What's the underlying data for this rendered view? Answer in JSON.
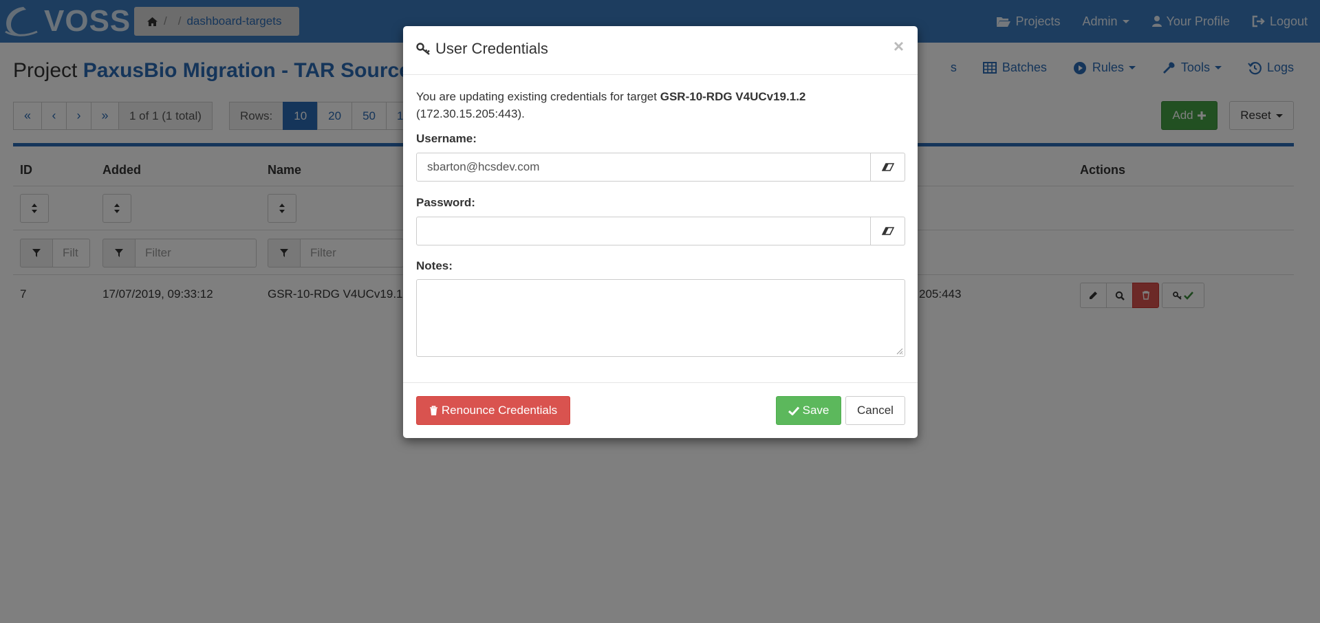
{
  "app": {
    "logo_text": "VOSS"
  },
  "breadcrumb": {
    "separator": "/",
    "current": "dashboard-targets"
  },
  "nav": {
    "projects": "Projects",
    "admin": "Admin",
    "profile": "Your Profile",
    "logout": "Logout"
  },
  "page": {
    "title_prefix": "Project",
    "project_name": "PaxusBio Migration - TAR Source"
  },
  "subnav": {
    "partial": "s",
    "batches": "Batches",
    "rules": "Rules",
    "tools": "Tools",
    "logs": "Logs"
  },
  "pager": {
    "first": "«",
    "prev": "‹",
    "next": "›",
    "last": "»",
    "info": "1 of 1 (1 total)"
  },
  "rows": {
    "label": "Rows:",
    "options": [
      "10",
      "20",
      "50",
      "1"
    ],
    "selected": "10"
  },
  "toolbar": {
    "add_label": "Add",
    "reset_label": "Reset"
  },
  "table": {
    "headers": {
      "id": "ID",
      "added": "Added",
      "name": "Name",
      "actions": "Actions"
    },
    "filters": {
      "id_placeholder": "Filt",
      "added_placeholder": "Filter",
      "name_placeholder": "Filter"
    },
    "rows": [
      {
        "id": "7",
        "added": "17/07/2019, 09:33:12",
        "name": "GSR-10-RDG V4UCv19.1",
        "address": "205:443"
      }
    ]
  },
  "modal": {
    "title": "User Credentials",
    "close": "×",
    "msg_prefix": "You are updating existing credentials for target",
    "target_name": "GSR-10-RDG V4UCv19.1.2",
    "target_address": "(172.30.15.205:443).",
    "username_label": "Username:",
    "username_value": "sbarton@hcsdev.com",
    "password_label": "Password:",
    "password_value": "",
    "notes_label": "Notes:",
    "notes_value": "",
    "renounce_label": "Renounce Credentials",
    "save_label": "Save",
    "cancel_label": "Cancel"
  },
  "colors": {
    "navbar": "#3a7bbf",
    "link": "#2a6ab4",
    "success": "#5cb85c",
    "danger": "#d9534f"
  }
}
